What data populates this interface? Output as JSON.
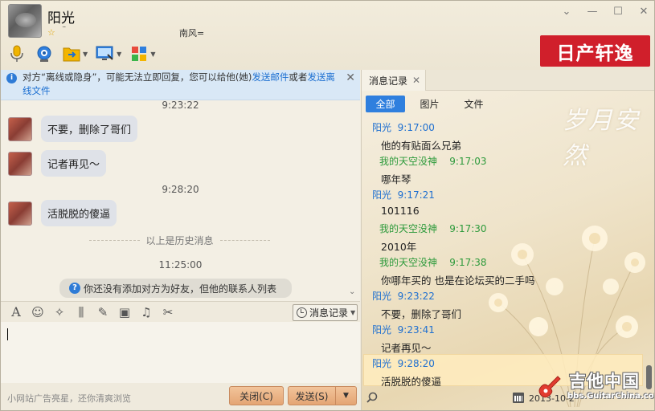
{
  "header": {
    "contact_name": "阳光",
    "tick": "¨",
    "signature": "南风=",
    "ad_banner": "日产轩逸",
    "window_controls": [
      "chevron-down-icon",
      "minimize-icon",
      "maximize-icon",
      "close-icon"
    ],
    "toolbar_icons": [
      "microphone-icon",
      "video-call-icon",
      "file-transfer-icon",
      "screen-share-icon",
      "apps-icon"
    ]
  },
  "notice": {
    "text_before": "对方“离线或隐身”，可能无法立即回复，您可以给他(她)",
    "link_email": "发送邮件",
    "text_mid": "或者",
    "link_offline_file": "发送离线文件"
  },
  "chat": {
    "times": [
      "9:23:22",
      "9:28:20",
      "11:25:00"
    ],
    "messages": [
      {
        "text": "不要，删除了哥们"
      },
      {
        "text": "记者再见～"
      },
      {
        "text": "活脱脱的傻逼"
      }
    ],
    "history_divider": "以上是历史消息",
    "friend_tip": "你还没有添加对方为好友，但他的联系人列表"
  },
  "input_toolbar": {
    "history_button": "消息记录",
    "icons": [
      "font-icon",
      "emoji-icon",
      "magic-wand-icon",
      "shake-icon",
      "screenshot-icon",
      "image-icon",
      "music-icon",
      "scissors-icon"
    ]
  },
  "footer": {
    "ad_text": "小网站广告亮星，还你清爽浏览",
    "close_label": "关闭(C)",
    "send_label": "发送(S)"
  },
  "history_panel": {
    "tab_label": "消息记录",
    "filters": [
      "全部",
      "图片",
      "文件"
    ],
    "deco_text": "岁月安然",
    "entries": [
      {
        "sender": "阳光",
        "time": "9:17:00",
        "who": "other",
        "text": "他的有贴面么兄弟"
      },
      {
        "sender": "我的天空没神",
        "time": "9:17:03",
        "who": "me",
        "text": "哪年琴"
      },
      {
        "sender": "阳光",
        "time": "9:17:21",
        "who": "other",
        "text": "101116"
      },
      {
        "sender": "我的天空没神",
        "time": "9:17:30",
        "who": "me",
        "text": "2010年"
      },
      {
        "sender": "我的天空没神",
        "time": "9:17:38",
        "who": "me",
        "text": "你哪年买的 也是在论坛买的二手吗"
      },
      {
        "sender": "阳光",
        "time": "9:23:22",
        "who": "other",
        "text": "不要，删除了哥们"
      },
      {
        "sender": "阳光",
        "time": "9:23:41",
        "who": "other",
        "text": "记者再见～"
      },
      {
        "sender": "阳光",
        "time": "9:28:20",
        "who": "other",
        "text": "活脱脱的傻逼"
      }
    ],
    "date_text": "2013-10-2",
    "watermark_title": "吉他中国",
    "watermark_url": "bbs.GuitarChina.com"
  }
}
